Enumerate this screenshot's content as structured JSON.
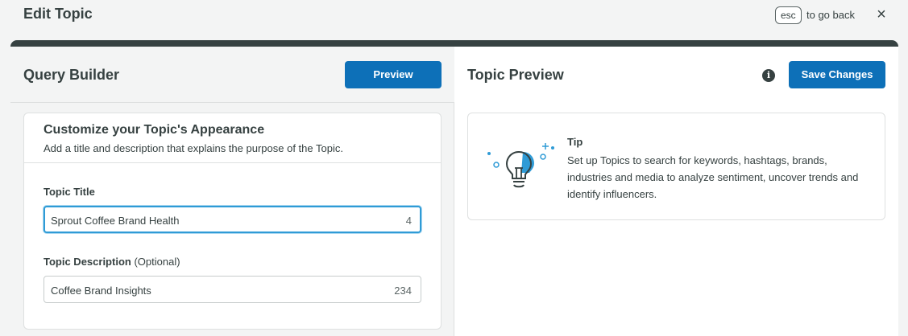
{
  "header": {
    "title": "Edit Topic",
    "esc_key": "esc",
    "esc_text": "to go back",
    "close_symbol": "×"
  },
  "query_builder": {
    "title": "Query Builder",
    "preview_label": "Preview",
    "card": {
      "title": "Customize your Topic's Appearance",
      "subtitle": "Add a title and description that explains the purpose of the Topic.",
      "topic_title": {
        "label": "Topic Title",
        "value": "Sprout Coffee Brand Health",
        "count": "4"
      },
      "topic_description": {
        "label": "Topic Description",
        "optional": "(Optional)",
        "value": "Coffee Brand Insights",
        "count": "234"
      }
    }
  },
  "topic_preview": {
    "title": "Topic Preview",
    "info_symbol": "i",
    "save_label": "Save Changes",
    "tip": {
      "title": "Tip",
      "body": "Set up Topics to search for keywords, hashtags, brands, industries and media to analyze sentiment, uncover trends and identify influencers.",
      "icon": "lightbulb-icon"
    }
  },
  "colors": {
    "primary": "#0d70b8",
    "accent": "#2f9bd6",
    "text": "#364141"
  }
}
